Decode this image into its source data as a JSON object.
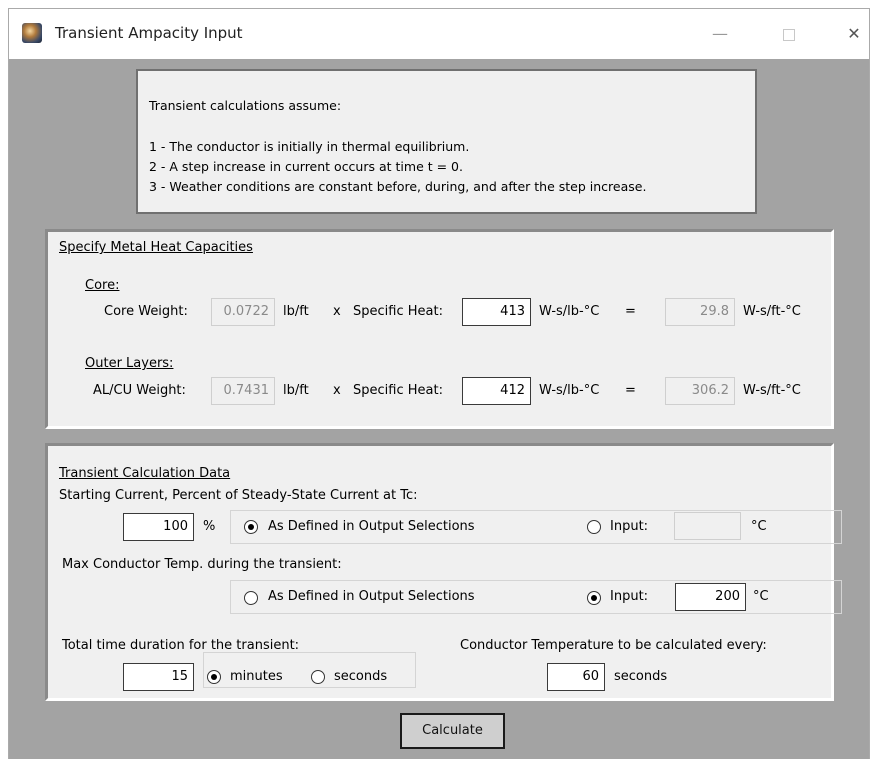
{
  "window": {
    "title": "Transient Ampacity Input",
    "controls": {
      "minimize": "—",
      "close": "✕"
    }
  },
  "info": {
    "heading": "Transient calculations assume:",
    "lines": [
      "1 - The conductor is initially in thermal equilibrium.",
      "2 - A step increase in current occurs at time t = 0.",
      "3 - Weather conditions are constant before, during, and after the step increase."
    ]
  },
  "heat_capacities": {
    "title": "Specify Metal Heat Capacities",
    "core": {
      "label": "Core:",
      "weight_label": "Core Weight:",
      "weight": "0.0722",
      "weight_unit": "lb/ft",
      "times": "x",
      "specific_heat_label": "Specific Heat:",
      "specific_heat": "413",
      "specific_heat_unit": "W-s/lb-°C",
      "equals": "=",
      "result": "29.8",
      "result_unit": "W-s/ft-°C"
    },
    "outer": {
      "label": "Outer Layers:",
      "weight_label": "AL/CU Weight:",
      "weight": "0.7431",
      "weight_unit": "lb/ft",
      "times": "x",
      "specific_heat_label": "Specific Heat:",
      "specific_heat": "412",
      "specific_heat_unit": "W-s/lb-°C",
      "equals": "=",
      "result": "306.2",
      "result_unit": "W-s/ft-°C"
    }
  },
  "transient": {
    "title": "Transient Calculation Data",
    "starting_current": {
      "label": "Starting Current, Percent of Steady-State Current at Tc:",
      "value": "100",
      "unit": "%",
      "option_defined": "As Defined in Output Selections",
      "option_input": "Input:",
      "selected": "defined",
      "input_value": "",
      "temp_unit": "°C"
    },
    "max_temp": {
      "label": "Max Conductor Temp. during the transient:",
      "option_defined": "As Defined in Output Selections",
      "option_input": "Input:",
      "selected": "input",
      "input_value": "200",
      "temp_unit": "°C"
    },
    "duration": {
      "label": "Total time duration for the transient:",
      "value": "15",
      "option_minutes": "minutes",
      "option_seconds": "seconds",
      "selected": "minutes"
    },
    "interval": {
      "label": "Conductor Temperature to be calculated every:",
      "value": "60",
      "unit": "seconds"
    }
  },
  "actions": {
    "calculate": "Calculate"
  }
}
